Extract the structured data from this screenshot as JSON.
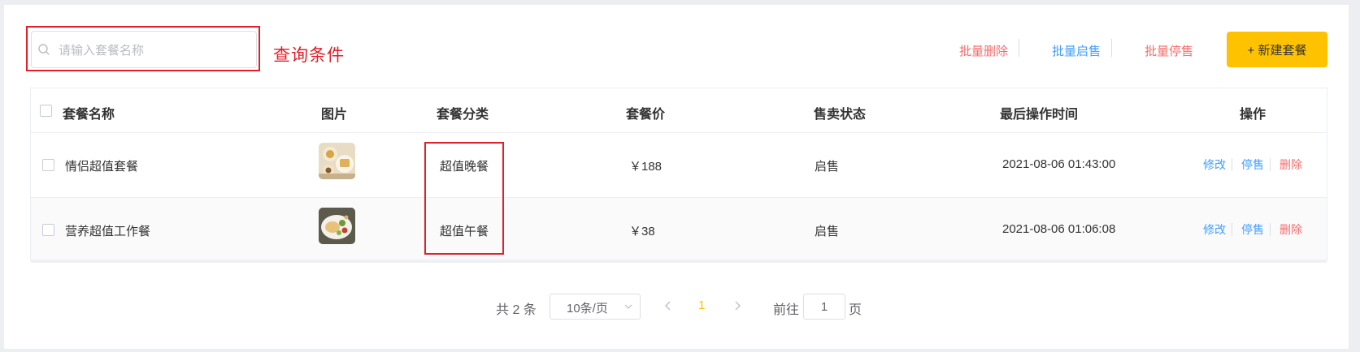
{
  "search": {
    "placeholder": "请输入套餐名称",
    "value": "",
    "annotation": "查询条件"
  },
  "toolbar": {
    "batch_delete": "批量删除",
    "batch_enable": "批量启售",
    "batch_disable": "批量停售",
    "new_button": "+ 新建套餐"
  },
  "table": {
    "headers": {
      "name": "套餐名称",
      "image": "图片",
      "category": "套餐分类",
      "price": "套餐价",
      "status": "售卖状态",
      "updated": "最后操作时间",
      "actions": "操作"
    },
    "rows": [
      {
        "name": "情侣超值套餐",
        "category": "超值晚餐",
        "price": "￥188",
        "status": "启售",
        "updated": "2021-08-06 01:43:00",
        "actions": {
          "edit": "修改",
          "toggle": "停售",
          "delete": "删除"
        }
      },
      {
        "name": "营养超值工作餐",
        "category": "超值午餐",
        "price": "￥38",
        "status": "启售",
        "updated": "2021-08-06 01:06:08",
        "actions": {
          "edit": "修改",
          "toggle": "停售",
          "delete": "删除"
        }
      }
    ]
  },
  "pagination": {
    "total": "共 2 条",
    "page_size": "10条/页",
    "current_page": "1",
    "goto_prefix": "前往",
    "goto_value": "1",
    "goto_suffix": "页"
  },
  "colors": {
    "accent": "#ffc200",
    "link_blue": "#419eff",
    "danger_red": "#f56c6c",
    "annotation_red": "#e0202a"
  },
  "icons": {
    "search": "search-icon",
    "prev": "chevron-left-icon",
    "next": "chevron-right-icon",
    "dropdown": "chevron-down-icon"
  }
}
